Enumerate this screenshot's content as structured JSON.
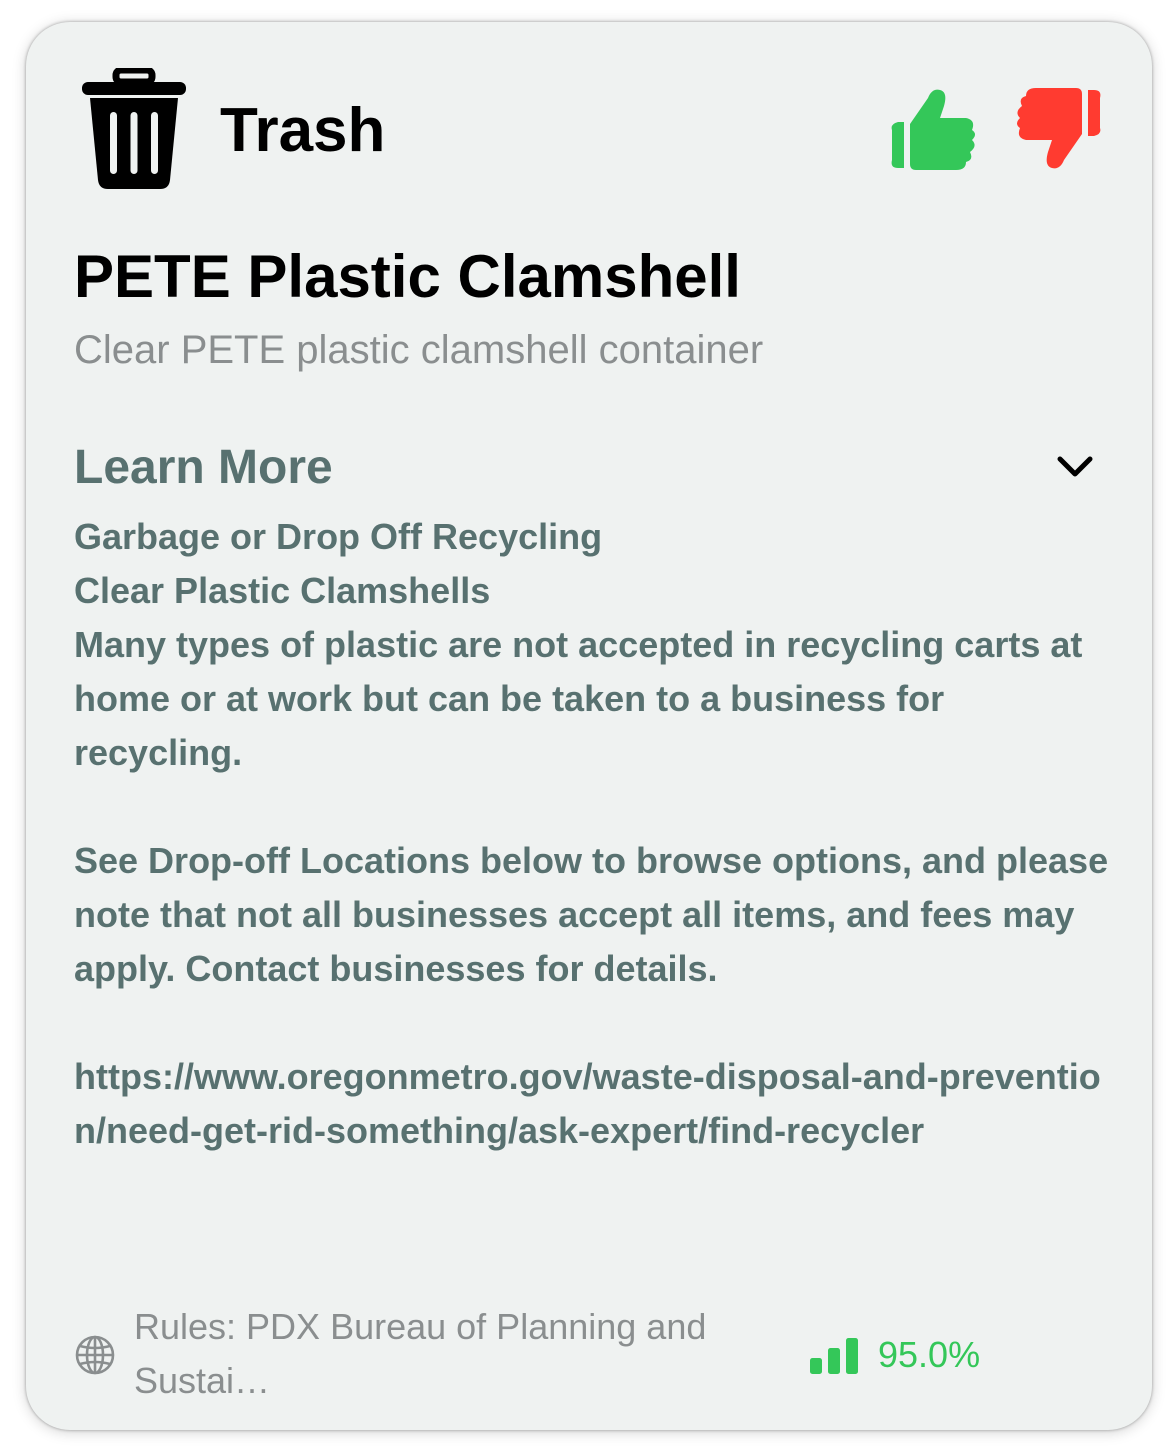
{
  "header": {
    "category": "Trash",
    "icon": "trash-can-icon",
    "thumbs_up_color": "#34c759",
    "thumbs_down_color": "#ff3b30"
  },
  "item": {
    "title": "PETE Plastic Clamshell",
    "subtitle": "Clear PETE plastic clamshell container"
  },
  "learn_more": {
    "label": "Learn More",
    "line1": "Garbage or Drop Off Recycling",
    "line2": "Clear Plastic Clamshells",
    "paragraph1": "Many types of plastic are not accepted in recycling carts at home or at work but can be taken to a business for recycling.",
    "paragraph2": "See Drop-off Locations below to browse options, and please note that not all businesses accept all items, and fees may apply. Contact businesses for details.",
    "url": "https://www.oregonmetro.gov/waste-disposal-and-prevention/need-get-rid-something/ask-expert/find-recycler"
  },
  "footer": {
    "rules": "Rules: PDX Bureau of Planning and Sustai…",
    "confidence": "95.0%",
    "confidence_color": "#34c759"
  }
}
